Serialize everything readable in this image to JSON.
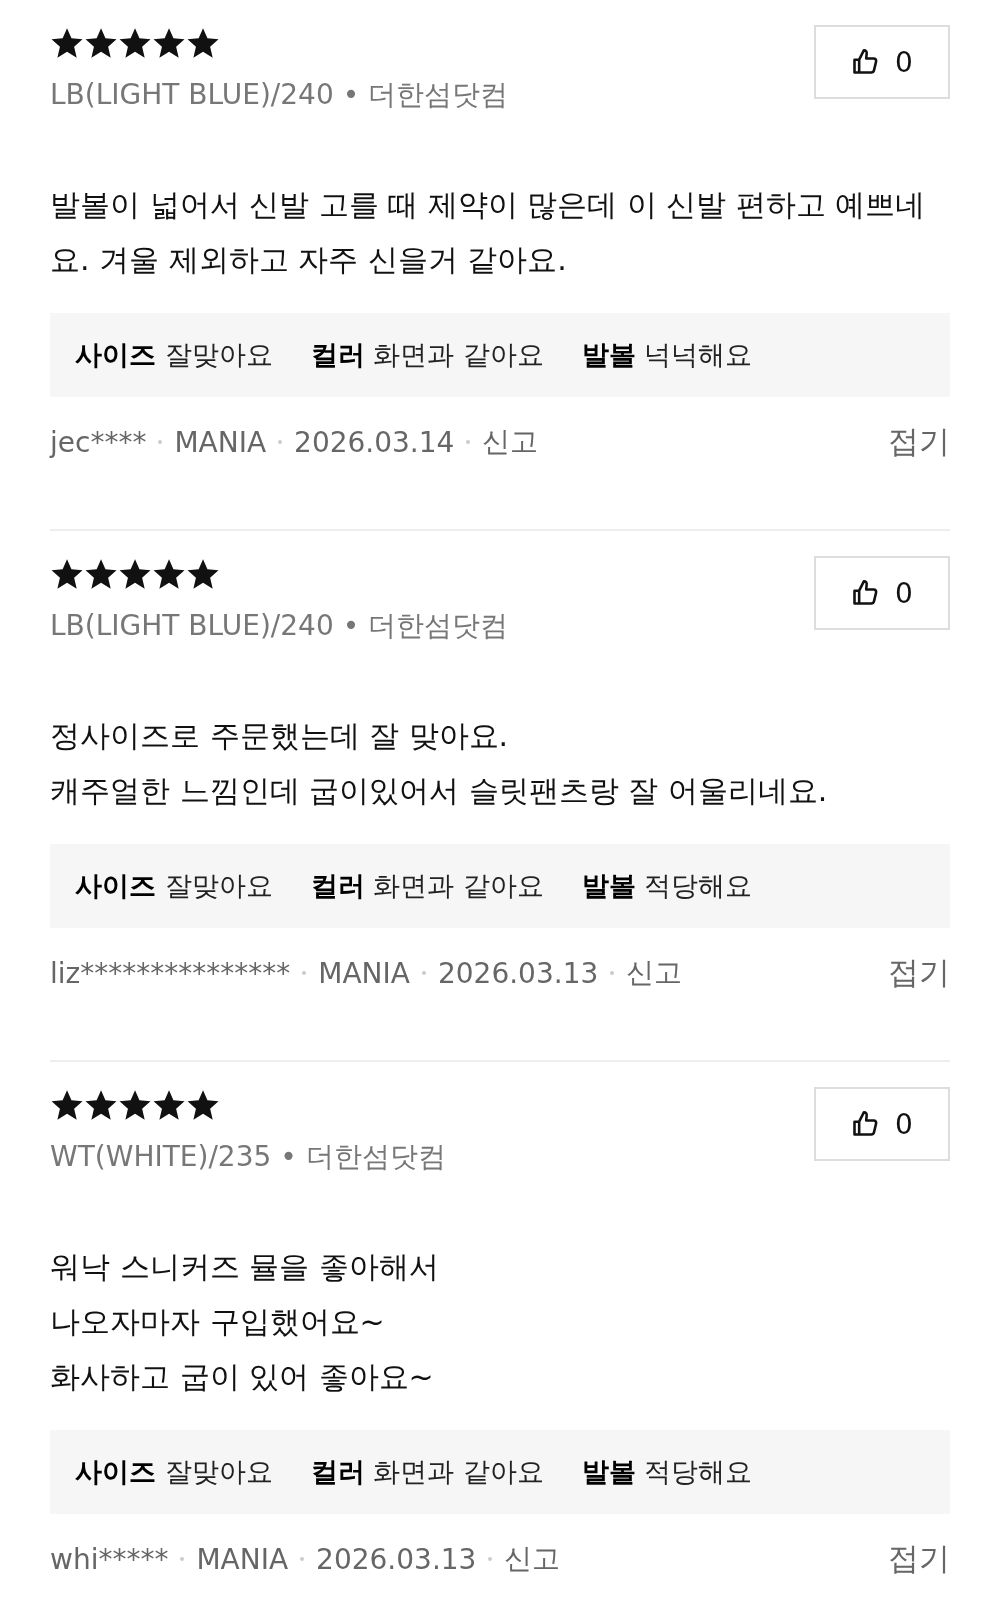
{
  "reviews": [
    {
      "stars": 5,
      "likes": "0",
      "option": "LB(LIGHT BLUE)/240 • 더한섬닷컴",
      "content": [
        "발볼이 넓어서 신발 고를 때 제약이 많은데 이 신발 편하고 예쁘네요. 겨울 제외하고 자주 신을거 같아요."
      ],
      "tags": [
        {
          "label": "사이즈",
          "value": "잘맞아요"
        },
        {
          "label": "컬러",
          "value": "화면과 같아요"
        },
        {
          "label": "발볼",
          "value": "넉넉해요"
        }
      ],
      "user": "jec****",
      "grade": "MANIA",
      "date": "2026.03.14",
      "report": "신고",
      "collapse": "접기"
    },
    {
      "stars": 5,
      "likes": "0",
      "option": "LB(LIGHT BLUE)/240 • 더한섬닷컴",
      "content": [
        "정사이즈로 주문했는데 잘 맞아요.",
        "캐주얼한 느낌인데 굽이있어서 슬릿팬츠랑 잘 어울리네요."
      ],
      "tags": [
        {
          "label": "사이즈",
          "value": "잘맞아요"
        },
        {
          "label": "컬러",
          "value": "화면과 같아요"
        },
        {
          "label": "발볼",
          "value": "적당해요"
        }
      ],
      "user": "liz***************",
      "grade": "MANIA",
      "date": "2026.03.13",
      "report": "신고",
      "collapse": "접기"
    },
    {
      "stars": 5,
      "likes": "0",
      "option": "WT(WHITE)/235 • 더한섬닷컴",
      "content": [
        "워낙 스니커즈 뮬을 좋아해서",
        "나오자마자 구입했어요~",
        "화사하고 굽이 있어 좋아요~"
      ],
      "tags": [
        {
          "label": "사이즈",
          "value": "잘맞아요"
        },
        {
          "label": "컬러",
          "value": "화면과 같아요"
        },
        {
          "label": "발볼",
          "value": "적당해요"
        }
      ],
      "user": "whi*****",
      "grade": "MANIA",
      "date": "2026.03.13",
      "report": "신고",
      "collapse": "접기"
    }
  ]
}
